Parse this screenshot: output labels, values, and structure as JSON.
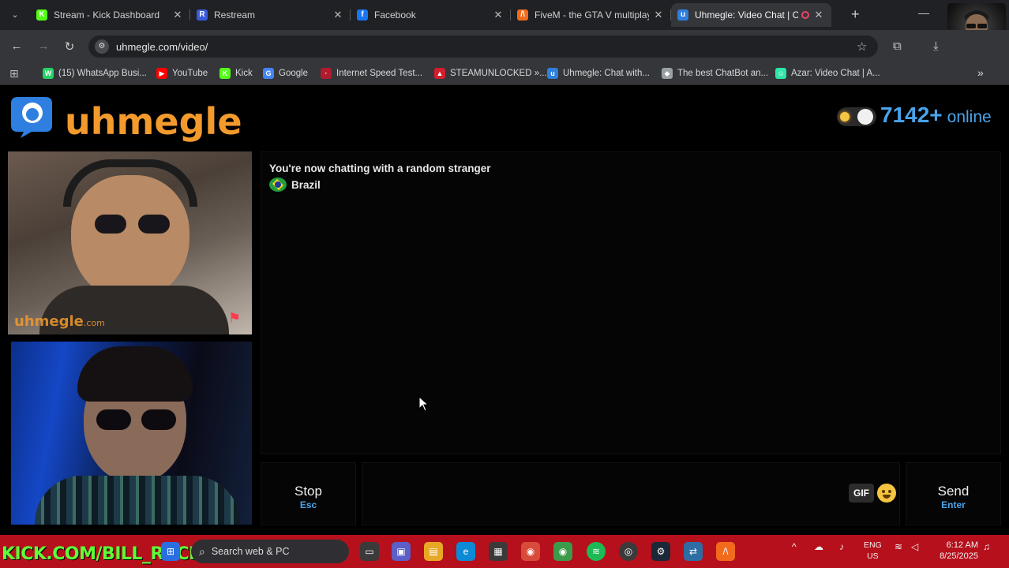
{
  "browser": {
    "tabs": [
      {
        "title": "Stream - Kick Dashboard",
        "icon": "K",
        "color": "#53fc18",
        "active": false
      },
      {
        "title": "Restream",
        "icon": "R",
        "color": "#3b5bdb",
        "active": false
      },
      {
        "title": "Facebook",
        "icon": "f",
        "color": "#1877f2",
        "active": false
      },
      {
        "title": "FiveM - the GTA V multiplay",
        "icon": "/\\",
        "color": "#f26b1d",
        "active": false
      },
      {
        "title": "Uhmegle: Video Chat | C",
        "icon": "u",
        "color": "#2f7fe0",
        "active": true
      }
    ],
    "new_tab": "+",
    "minimize": "—",
    "url": "uhmegle.com/video/",
    "bookmarks": [
      {
        "label": "(15) WhatsApp Busi...",
        "color": "#25d366",
        "icon": "W"
      },
      {
        "label": "YouTube",
        "color": "#ff0000",
        "icon": "▶"
      },
      {
        "label": "Kick",
        "color": "#53fc18",
        "icon": "K"
      },
      {
        "label": "Google",
        "color": "#4285f4",
        "icon": "G"
      },
      {
        "label": "Internet Speed Test...",
        "color": "#b01c2e",
        "icon": "·"
      },
      {
        "label": "STEAMUNLOCKED »...",
        "color": "#d11f2e",
        "icon": "▲"
      },
      {
        "label": "Uhmegle: Chat with...",
        "color": "#2f7fe0",
        "icon": "u"
      },
      {
        "label": "The best ChatBot an...",
        "color": "#9aa0a6",
        "icon": "◆"
      },
      {
        "label": "Azar: Video Chat | A...",
        "color": "#2ee6a8",
        "icon": "☺"
      }
    ],
    "more_bookmarks": "»"
  },
  "site": {
    "logo_text": "uhmegle",
    "online_count": "7142+",
    "online_label": "online",
    "watermark": "uhmegle",
    "watermark_tld": ".com"
  },
  "chat": {
    "notice": "You're now chatting with a random stranger",
    "country": "Brazil",
    "message_value": ""
  },
  "controls": {
    "stop_label": "Stop",
    "stop_key": "Esc",
    "gif_label": "GIF",
    "send_label": "Send",
    "send_key": "Enter"
  },
  "taskbar": {
    "overlay_text": "KICK.COM/BILL_RACK",
    "search_placeholder": "Search web & PC",
    "lang_line1": "ENG",
    "lang_line2": "US",
    "time": "6:12 AM",
    "date": "8/25/2025"
  }
}
